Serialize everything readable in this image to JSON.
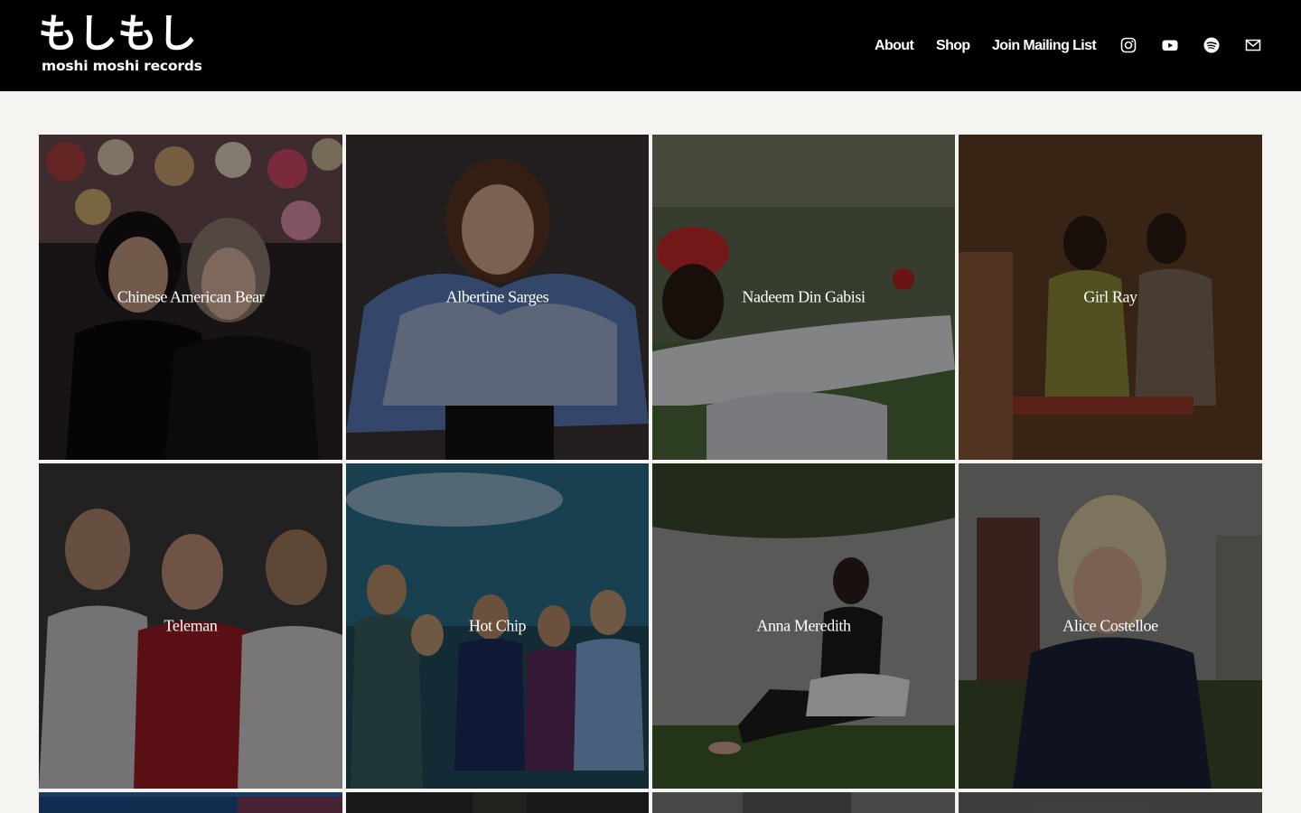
{
  "brand": {
    "logo_japanese": "もしもし",
    "logo_text": "moshi moshi records"
  },
  "nav": {
    "links": [
      {
        "label": "About"
      },
      {
        "label": "Shop"
      },
      {
        "label": "Join Mailing List"
      }
    ],
    "social_icons": [
      "instagram-icon",
      "youtube-icon",
      "spotify-icon",
      "email-icon"
    ]
  },
  "artists": [
    {
      "name": "Chinese American Bear"
    },
    {
      "name": "Albertine Sarges"
    },
    {
      "name": "Nadeem Din Gabisi"
    },
    {
      "name": "Girl Ray"
    },
    {
      "name": "Teleman"
    },
    {
      "name": "Hot Chip"
    },
    {
      "name": "Anna Meredith"
    },
    {
      "name": "Alice Costelloe"
    }
  ],
  "colors": {
    "header_bg": "#000000",
    "page_bg": "#f5f4f0",
    "text_on_dark": "#ffffff"
  }
}
